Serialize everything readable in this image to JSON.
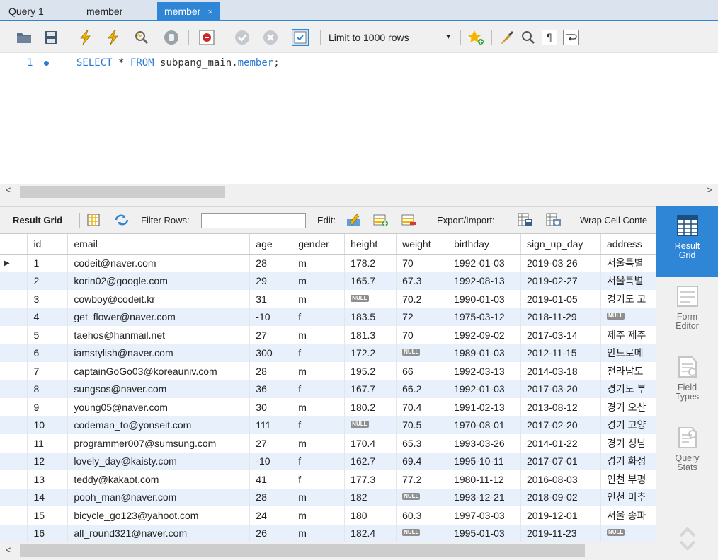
{
  "tabs": [
    {
      "label": "Query 1"
    },
    {
      "label": "member"
    },
    {
      "label": "member",
      "close": "×"
    }
  ],
  "query_toolbar": {
    "limit_label": "Limit to 1000 rows"
  },
  "editor": {
    "line_number": "1",
    "sql_keyword_select": "SELECT",
    "sql_star": "*",
    "sql_keyword_from": "FROM",
    "sql_schema": "subpang_main.",
    "sql_table": "member",
    "sql_end": ";"
  },
  "result_toolbar": {
    "result_grid": "Result Grid",
    "filter_rows": "Filter Rows:",
    "filter_value": "",
    "edit": "Edit:",
    "export_import": "Export/Import:",
    "wrap_cell": "Wrap Cell Conte"
  },
  "grid": {
    "columns": [
      "id",
      "email",
      "age",
      "gender",
      "height",
      "weight",
      "birthday",
      "sign_up_day",
      "address"
    ],
    "rows": [
      [
        "1",
        "codeit@naver.com",
        "28",
        "m",
        "178.2",
        "70",
        "1992-01-03",
        "2019-03-26",
        "서울특별"
      ],
      [
        "2",
        "korin02@google.com",
        "29",
        "m",
        "165.7",
        "67.3",
        "1992-08-13",
        "2019-02-27",
        "서울특별"
      ],
      [
        "3",
        "cowboy@codeit.kr",
        "31",
        "m",
        "NULL",
        "70.2",
        "1990-01-03",
        "2019-01-05",
        "경기도 고"
      ],
      [
        "4",
        "get_flower@naver.com",
        "-10",
        "f",
        "183.5",
        "72",
        "1975-03-12",
        "2018-11-29",
        "NULL"
      ],
      [
        "5",
        "taehos@hanmail.net",
        "27",
        "m",
        "181.3",
        "70",
        "1992-09-02",
        "2017-03-14",
        "제주 제주"
      ],
      [
        "6",
        "iamstylish@naver.com",
        "300",
        "f",
        "172.2",
        "NULL",
        "1989-01-03",
        "2012-11-15",
        "안드로메"
      ],
      [
        "7",
        "captainGoGo03@koreauniv.com",
        "28",
        "m",
        "195.2",
        "66",
        "1992-03-13",
        "2014-03-18",
        "전라남도"
      ],
      [
        "8",
        "sungsos@naver.com",
        "36",
        "f",
        "167.7",
        "66.2",
        "1992-01-03",
        "2017-03-20",
        "경기도 부"
      ],
      [
        "9",
        "young05@naver.com",
        "30",
        "m",
        "180.2",
        "70.4",
        "1991-02-13",
        "2013-08-12",
        "경기 오산"
      ],
      [
        "10",
        "codeman_to@yonseit.com",
        "111",
        "f",
        "NULL",
        "70.5",
        "1970-08-01",
        "2017-02-20",
        "경기 고양"
      ],
      [
        "11",
        "programmer007@sumsung.com",
        "27",
        "m",
        "170.4",
        "65.3",
        "1993-03-26",
        "2014-01-22",
        "경기 성남"
      ],
      [
        "12",
        "lovely_day@kaisty.com",
        "-10",
        "f",
        "162.7",
        "69.4",
        "1995-10-11",
        "2017-07-01",
        "경기 화성"
      ],
      [
        "13",
        "teddy@kakaot.com",
        "41",
        "f",
        "177.3",
        "77.2",
        "1980-11-12",
        "2016-08-03",
        "인천 부평"
      ],
      [
        "14",
        "pooh_man@naver.com",
        "28",
        "m",
        "182",
        "NULL",
        "1993-12-21",
        "2018-09-02",
        "인천 미추"
      ],
      [
        "15",
        "bicycle_go123@yahoot.com",
        "24",
        "m",
        "180",
        "60.3",
        "1997-03-03",
        "2019-12-01",
        "서울 송파"
      ],
      [
        "16",
        "all_round321@naver.com",
        "26",
        "m",
        "182.4",
        "NULL",
        "1995-01-03",
        "2019-11-23",
        "NULL"
      ]
    ]
  },
  "side_panel": [
    {
      "label1": "Result",
      "label2": "Grid"
    },
    {
      "label1": "Form",
      "label2": "Editor"
    },
    {
      "label1": "Field",
      "label2": "Types"
    },
    {
      "label1": "Query",
      "label2": "Stats"
    }
  ],
  "colors": {
    "accent": "#2f86d6",
    "row_alt": "#e8f0fb",
    "null_badge": "#8e8e8e"
  }
}
